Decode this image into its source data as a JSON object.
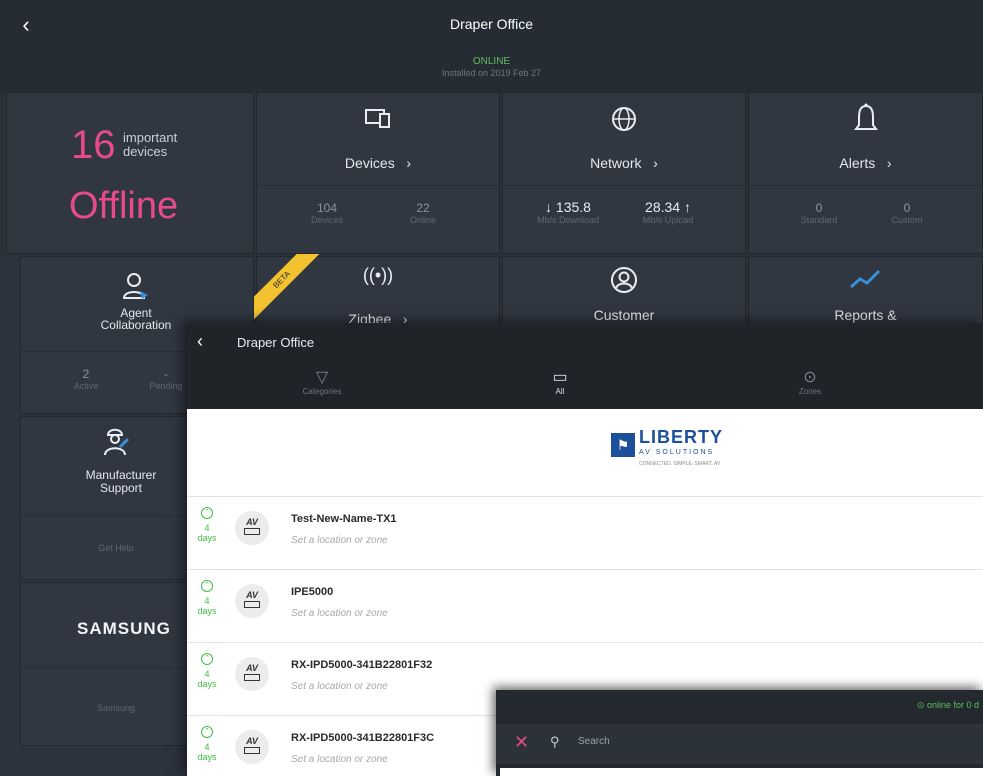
{
  "header": {
    "back_icon": "chevron-left-icon",
    "title": "Draper Office",
    "status": "ONLINE",
    "installed": "Installed on 2019 Feb 27"
  },
  "summary": {
    "count": "16",
    "count_label_1": "important",
    "count_label_2": "devices",
    "state": "Offline"
  },
  "tiles": {
    "devices": {
      "icon": "devices-icon",
      "label": "Devices",
      "stats": [
        {
          "value": "104",
          "label": "Devices"
        },
        {
          "value": "22",
          "label": "Online"
        }
      ]
    },
    "network": {
      "icon": "globe-icon",
      "label": "Network",
      "stats": [
        {
          "value": "135.8",
          "label": "Mb/s Download"
        },
        {
          "value": "28.34",
          "label": "Mb/s Upload"
        }
      ]
    },
    "alerts": {
      "icon": "bell-icon",
      "label": "Alerts",
      "stats": [
        {
          "value": "0",
          "label": "Standard"
        },
        {
          "value": "0",
          "label": "Custom"
        }
      ]
    },
    "agent": {
      "icon": "agent-icon",
      "label_1": "Agent",
      "label_2": "Collaboration",
      "stats": [
        {
          "value": "2",
          "label": "Active"
        },
        {
          "value": "-",
          "label": "Pending"
        }
      ]
    },
    "zigbee": {
      "icon": "wireless-icon",
      "label": "Zigbee",
      "badge": "BETA"
    },
    "customer": {
      "icon": "customer-icon",
      "label": "Customer"
    },
    "reports": {
      "icon": "chart-icon",
      "label": "Reports &"
    },
    "manufacturer": {
      "icon": "technician-icon",
      "label_1": "Manufacturer",
      "label_2": "Support",
      "link": "Get Help"
    },
    "samsung": {
      "brand": "SAMSUNG",
      "label": "Samsung"
    }
  },
  "device_panel": {
    "title": "Draper Office",
    "tabs": [
      {
        "icon": "filter-icon",
        "label": "Categories"
      },
      {
        "icon": "devices-icon",
        "label": "All"
      },
      {
        "icon": "zone-icon",
        "label": "Zones"
      }
    ],
    "brand_name": "LIBERTY",
    "brand_sub": "AV SOLUTIONS",
    "brand_tag": "CONNECTED. SIMPLE. SMART. AV",
    "rows": [
      {
        "uptime": "4",
        "unit": "days",
        "name": "Test-New-Name-TX1",
        "location": "Set a location or zone"
      },
      {
        "uptime": "4",
        "unit": "days",
        "name": "IPE5000",
        "location": "Set a location or zone"
      },
      {
        "uptime": "4",
        "unit": "days",
        "name": "RX-IPD5000-341B22801F32",
        "location": "Set a location or zone"
      },
      {
        "uptime": "4",
        "unit": "days",
        "name": "RX-IPD5000-341B22801F3C",
        "location": "Set a location or zone"
      }
    ]
  },
  "search_panel": {
    "online_for": "online for 0 d",
    "close_icon": "close-icon",
    "search_icon": "search-icon",
    "placeholder": "Search"
  },
  "colors": {
    "accent": "#e64a8b",
    "online": "#5dbf5d",
    "background": "#2b3139"
  }
}
